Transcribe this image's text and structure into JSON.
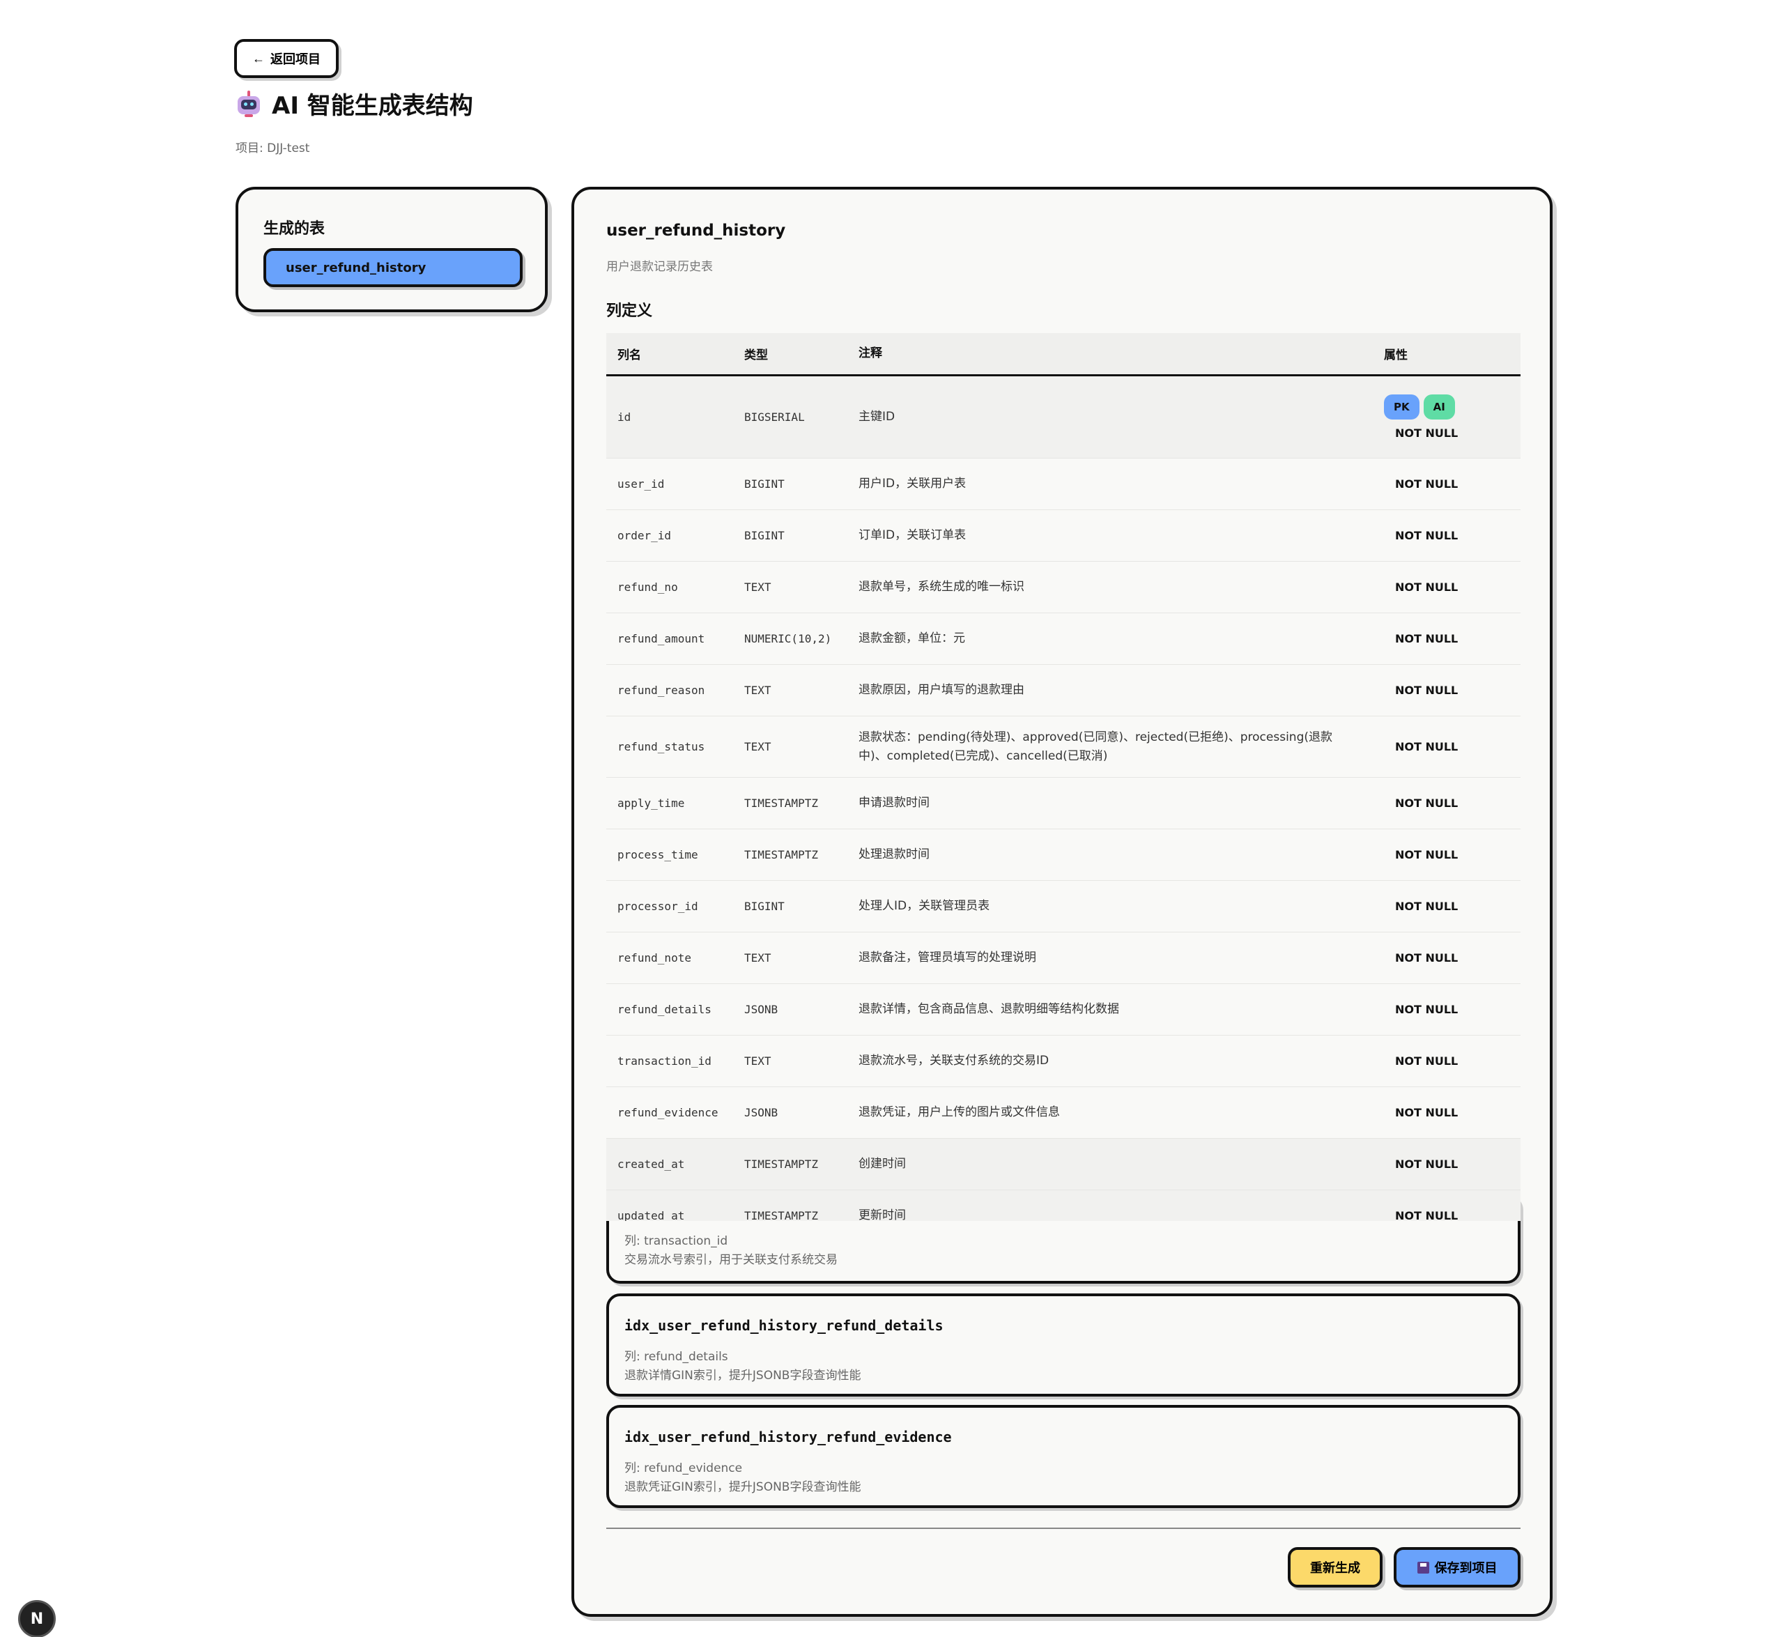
{
  "header": {
    "back_label": "返回项目",
    "back_arrow": "←",
    "title": "AI 智能生成表结构",
    "title_icon": "robot-icon",
    "project": "项目: DJJ-test"
  },
  "sidebar": {
    "title": "生成的表",
    "tables": [
      "user_refund_history"
    ]
  },
  "table": {
    "name": "user_refund_history",
    "comment": "用户退款记录历史表",
    "columns_title": "列定义",
    "headers": {
      "name": "列名",
      "type": "类型",
      "comment": "注释",
      "attrs": "属性"
    },
    "columns": [
      {
        "name": "id",
        "type": "BIGSERIAL",
        "comment": "主键ID",
        "pk": "PK",
        "ai": "AI",
        "attr": "NOT NULL"
      },
      {
        "name": "user_id",
        "type": "BIGINT",
        "comment": "用户ID，关联用户表",
        "attr": "NOT NULL"
      },
      {
        "name": "order_id",
        "type": "BIGINT",
        "comment": "订单ID，关联订单表",
        "attr": "NOT NULL"
      },
      {
        "name": "refund_no",
        "type": "TEXT",
        "comment": "退款单号，系统生成的唯一标识",
        "attr": "NOT NULL"
      },
      {
        "name": "refund_amount",
        "type": "NUMERIC(10,2)",
        "comment": "退款金额，单位：元",
        "attr": "NOT NULL"
      },
      {
        "name": "refund_reason",
        "type": "TEXT",
        "comment": "退款原因，用户填写的退款理由",
        "attr": "NOT NULL"
      },
      {
        "name": "refund_status",
        "type": "TEXT",
        "comment": "退款状态：pending(待处理)、approved(已同意)、rejected(已拒绝)、processing(退款中)、completed(已完成)、cancelled(已取消)",
        "attr": "NOT NULL"
      },
      {
        "name": "apply_time",
        "type": "TIMESTAMPTZ",
        "comment": "申请退款时间",
        "attr": "NOT NULL"
      },
      {
        "name": "process_time",
        "type": "TIMESTAMPTZ",
        "comment": "处理退款时间",
        "attr": "NOT NULL"
      },
      {
        "name": "processor_id",
        "type": "BIGINT",
        "comment": "处理人ID，关联管理员表",
        "attr": "NOT NULL"
      },
      {
        "name": "refund_note",
        "type": "TEXT",
        "comment": "退款备注，管理员填写的处理说明",
        "attr": "NOT NULL"
      },
      {
        "name": "refund_details",
        "type": "JSONB",
        "comment": "退款详情，包含商品信息、退款明细等结构化数据",
        "attr": "NOT NULL"
      },
      {
        "name": "transaction_id",
        "type": "TEXT",
        "comment": "退款流水号，关联支付系统的交易ID",
        "attr": "NOT NULL"
      },
      {
        "name": "refund_evidence",
        "type": "JSONB",
        "comment": "退款凭证，用户上传的图片或文件信息",
        "attr": "NOT NULL"
      },
      {
        "name": "created_at",
        "type": "TIMESTAMPTZ",
        "comment": "创建时间",
        "attr": "NOT NULL"
      },
      {
        "name": "updated_at",
        "type": "TIMESTAMPTZ",
        "comment": "更新时间",
        "attr": "NOT NULL"
      }
    ],
    "indexes": [
      {
        "name": "",
        "columns": "列: transaction_id",
        "desc": "交易流水号索引，用于关联支付系统交易"
      },
      {
        "name": "idx_user_refund_history_refund_details",
        "columns": "列: refund_details",
        "desc": "退款详情GIN索引，提升JSONB字段查询性能"
      },
      {
        "name": "idx_user_refund_history_refund_evidence",
        "columns": "列: refund_evidence",
        "desc": "退款凭证GIN索引，提升JSONB字段查询性能"
      }
    ]
  },
  "actions": {
    "regenerate": "重新生成",
    "save": "保存到项目",
    "save_icon": "floppy-disk-icon"
  },
  "dev_badge": "N",
  "colors": {
    "primary_blue": "#69a2fb",
    "accent_yellow": "#fcd96a",
    "ai_green": "#5fdca5"
  }
}
